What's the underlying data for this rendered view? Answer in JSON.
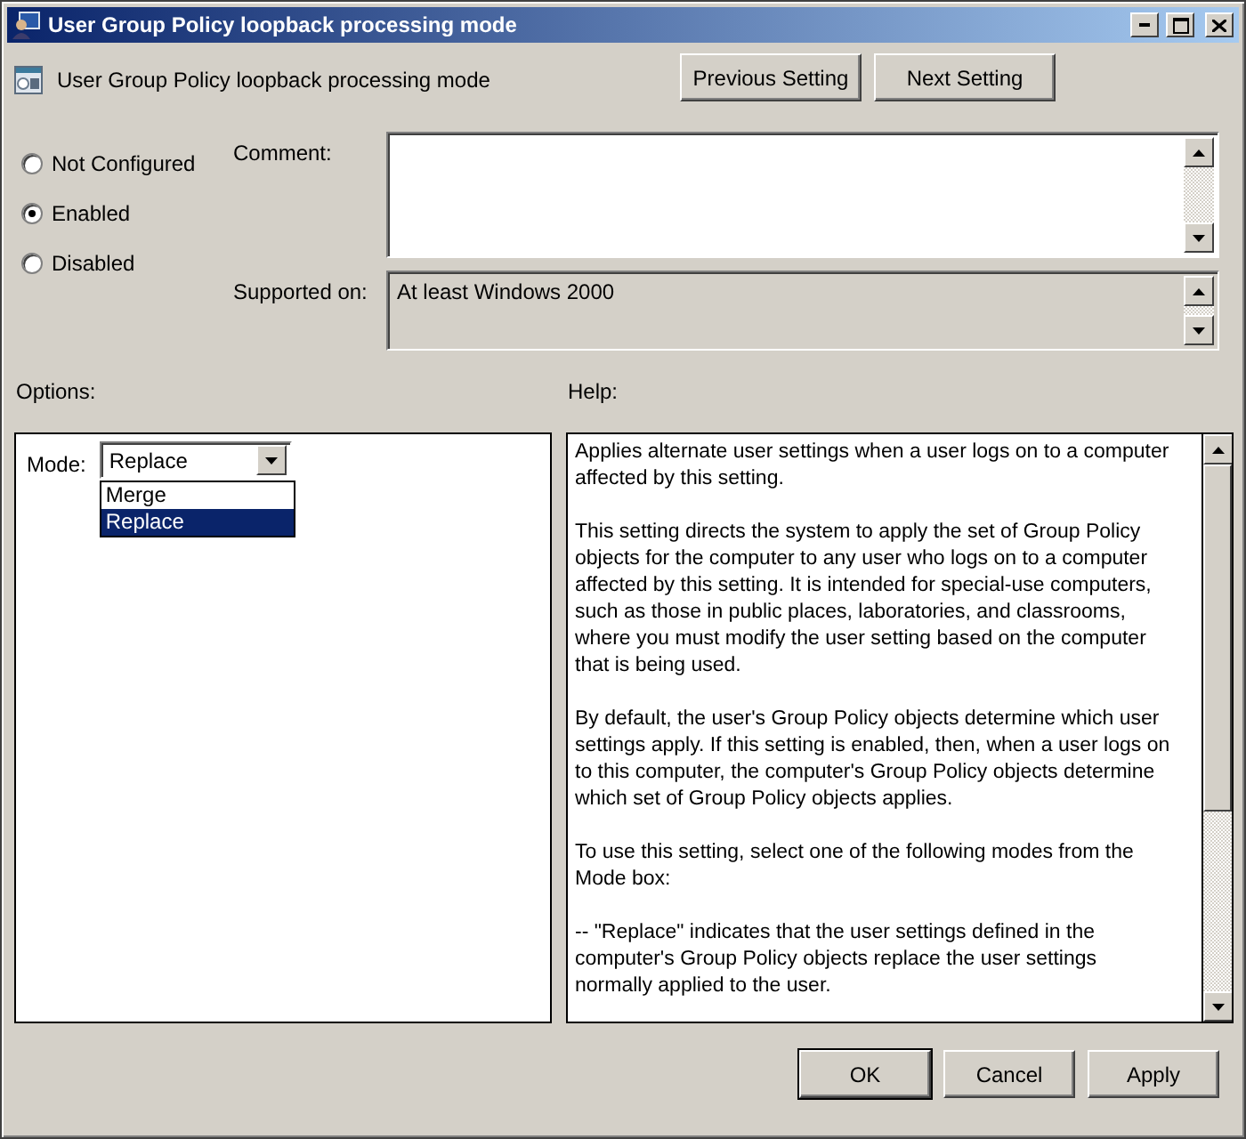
{
  "window": {
    "title": "User Group Policy loopback processing mode"
  },
  "header": {
    "title": "User Group Policy loopback processing mode",
    "buttons": [
      "Previous Setting",
      "Next Setting"
    ]
  },
  "state_options": [
    {
      "label": "Not Configured",
      "selected": false
    },
    {
      "label": "Enabled",
      "selected": true
    },
    {
      "label": "Disabled",
      "selected": false
    }
  ],
  "comment": {
    "label": "Comment:"
  },
  "supported_on": {
    "label": "Supported on:",
    "value": "At least Windows 2000"
  },
  "options": {
    "label": "Options:",
    "mode": {
      "label": "Mode:",
      "value": "Replace",
      "expanded": true,
      "choices": [
        {
          "label": "Merge",
          "selected": false
        },
        {
          "label": "Replace",
          "selected": true
        }
      ]
    }
  },
  "help": {
    "label": "Help:",
    "paragraphs": [
      "Applies alternate user settings when a user logs on to a computer affected by this setting.",
      "This setting directs the system to apply the set of Group Policy objects for the computer to any user who logs on to a computer affected by this setting. It is intended for special-use computers, such as those in public places, laboratories, and classrooms, where you must modify the user setting based on the computer that is being used.",
      "By default, the user's Group Policy objects determine which user settings apply. If this setting is enabled, then, when a user logs on to this computer, the computer's Group Policy objects determine which set of Group Policy objects applies.",
      "To use this setting, select one of the following modes from the Mode box:",
      "--   \"Replace\" indicates that the user settings defined in the computer's Group Policy objects replace the user settings normally applied to the user."
    ]
  },
  "buttons": [
    {
      "label": "OK",
      "default": true
    },
    {
      "label": "Cancel",
      "default": false
    },
    {
      "label": "Apply",
      "default": false
    }
  ]
}
